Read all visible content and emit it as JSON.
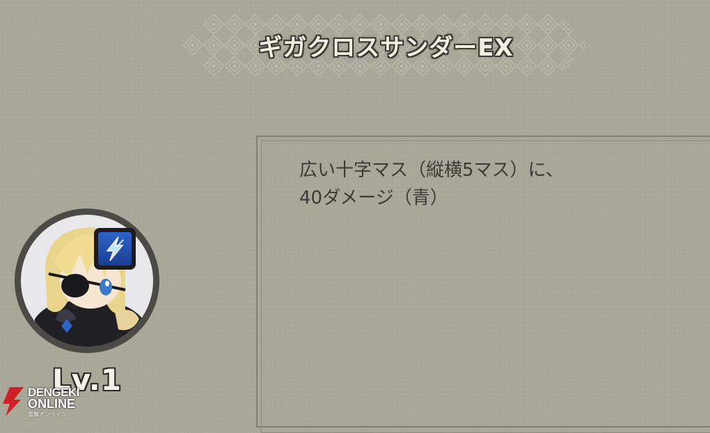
{
  "skill": {
    "name": "ギガクロスサンダーEX",
    "description": [
      "広い十字マス（縦横5マス）に、",
      "40ダメージ（青）"
    ]
  },
  "character": {
    "level": "Lv.1",
    "element_icon": "lightning-icon",
    "element_color": "#2e63c8"
  },
  "watermark": {
    "line1": "DENGEKI",
    "line2": "ONLINE",
    "line3": "電撃オンライン"
  },
  "colors": {
    "background": "#a9a898",
    "title_text": "#f2efe2",
    "body_text": "#3b3b36"
  }
}
